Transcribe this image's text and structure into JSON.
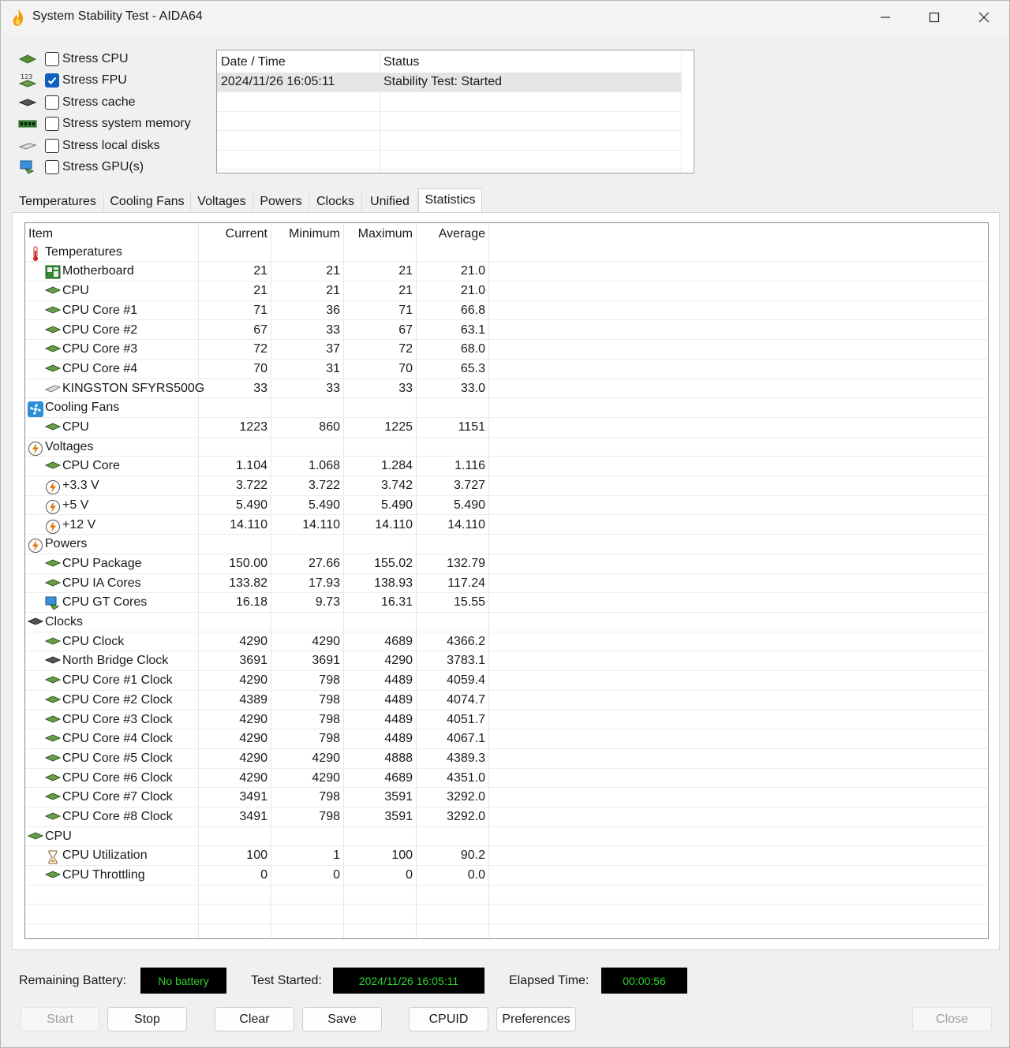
{
  "window": {
    "title": "System Stability Test - AIDA64"
  },
  "stress": [
    {
      "label": "Stress CPU",
      "checked": false,
      "icon": "cpu-chip-icon"
    },
    {
      "label": "Stress FPU",
      "checked": true,
      "icon": "fpu-numbers-icon"
    },
    {
      "label": "Stress cache",
      "checked": false,
      "icon": "cache-chip-icon"
    },
    {
      "label": "Stress system memory",
      "checked": false,
      "icon": "memory-module-icon"
    },
    {
      "label": "Stress local disks",
      "checked": false,
      "icon": "disk-drive-icon"
    },
    {
      "label": "Stress GPU(s)",
      "checked": false,
      "icon": "gpu-monitor-icon"
    }
  ],
  "log": {
    "headers": {
      "datetime": "Date / Time",
      "status": "Status"
    },
    "rows": [
      {
        "datetime": "2024/11/26 16:05:11",
        "status": "Stability Test: Started"
      }
    ]
  },
  "tabs": [
    "Temperatures",
    "Cooling Fans",
    "Voltages",
    "Powers",
    "Clocks",
    "Unified",
    "Statistics"
  ],
  "active_tab": "Statistics",
  "stats": {
    "headers": {
      "item": "Item",
      "current": "Current",
      "minimum": "Minimum",
      "maximum": "Maximum",
      "average": "Average"
    },
    "rows": [
      {
        "type": "group",
        "label": "Temperatures",
        "icon": "thermometer-icon"
      },
      {
        "type": "item",
        "label": "Motherboard",
        "icon": "motherboard-icon",
        "current": "21",
        "min": "21",
        "max": "21",
        "avg": "21.0"
      },
      {
        "type": "item",
        "label": "CPU",
        "icon": "cpu-chip-icon",
        "current": "21",
        "min": "21",
        "max": "21",
        "avg": "21.0"
      },
      {
        "type": "item",
        "label": "CPU Core #1",
        "icon": "cpu-chip-icon",
        "current": "71",
        "min": "36",
        "max": "71",
        "avg": "66.8"
      },
      {
        "type": "item",
        "label": "CPU Core #2",
        "icon": "cpu-chip-icon",
        "current": "67",
        "min": "33",
        "max": "67",
        "avg": "63.1"
      },
      {
        "type": "item",
        "label": "CPU Core #3",
        "icon": "cpu-chip-icon",
        "current": "72",
        "min": "37",
        "max": "72",
        "avg": "68.0"
      },
      {
        "type": "item",
        "label": "CPU Core #4",
        "icon": "cpu-chip-icon",
        "current": "70",
        "min": "31",
        "max": "70",
        "avg": "65.3"
      },
      {
        "type": "item",
        "label": "KINGSTON SFYRS500G",
        "icon": "disk-drive-icon",
        "current": "33",
        "min": "33",
        "max": "33",
        "avg": "33.0"
      },
      {
        "type": "group",
        "label": "Cooling Fans",
        "icon": "fan-icon"
      },
      {
        "type": "item",
        "label": "CPU",
        "icon": "cpu-chip-icon",
        "current": "1223",
        "min": "860",
        "max": "1225",
        "avg": "1151"
      },
      {
        "type": "group",
        "label": "Voltages",
        "icon": "lightning-icon"
      },
      {
        "type": "item",
        "label": "CPU Core",
        "icon": "cpu-chip-icon",
        "current": "1.104",
        "min": "1.068",
        "max": "1.284",
        "avg": "1.116"
      },
      {
        "type": "item",
        "label": "+3.3 V",
        "icon": "lightning-icon",
        "current": "3.722",
        "min": "3.722",
        "max": "3.742",
        "avg": "3.727"
      },
      {
        "type": "item",
        "label": "+5 V",
        "icon": "lightning-icon",
        "current": "5.490",
        "min": "5.490",
        "max": "5.490",
        "avg": "5.490"
      },
      {
        "type": "item",
        "label": "+12 V",
        "icon": "lightning-icon",
        "current": "14.110",
        "min": "14.110",
        "max": "14.110",
        "avg": "14.110"
      },
      {
        "type": "group",
        "label": "Powers",
        "icon": "lightning-icon"
      },
      {
        "type": "item",
        "label": "CPU Package",
        "icon": "cpu-chip-icon",
        "current": "150.00",
        "min": "27.66",
        "max": "155.02",
        "avg": "132.79"
      },
      {
        "type": "item",
        "label": "CPU IA Cores",
        "icon": "cpu-chip-icon",
        "current": "133.82",
        "min": "17.93",
        "max": "138.93",
        "avg": "117.24"
      },
      {
        "type": "item",
        "label": "CPU GT Cores",
        "icon": "gpu-monitor-icon",
        "current": "16.18",
        "min": "9.73",
        "max": "16.31",
        "avg": "15.55"
      },
      {
        "type": "group",
        "label": "Clocks",
        "icon": "chip-icon"
      },
      {
        "type": "item",
        "label": "CPU Clock",
        "icon": "cpu-chip-icon",
        "current": "4290",
        "min": "4290",
        "max": "4689",
        "avg": "4366.2"
      },
      {
        "type": "item",
        "label": "North Bridge Clock",
        "icon": "chip-icon",
        "current": "3691",
        "min": "3691",
        "max": "4290",
        "avg": "3783.1"
      },
      {
        "type": "item",
        "label": "CPU Core #1 Clock",
        "icon": "cpu-chip-icon",
        "current": "4290",
        "min": "798",
        "max": "4489",
        "avg": "4059.4"
      },
      {
        "type": "item",
        "label": "CPU Core #2 Clock",
        "icon": "cpu-chip-icon",
        "current": "4389",
        "min": "798",
        "max": "4489",
        "avg": "4074.7"
      },
      {
        "type": "item",
        "label": "CPU Core #3 Clock",
        "icon": "cpu-chip-icon",
        "current": "4290",
        "min": "798",
        "max": "4489",
        "avg": "4051.7"
      },
      {
        "type": "item",
        "label": "CPU Core #4 Clock",
        "icon": "cpu-chip-icon",
        "current": "4290",
        "min": "798",
        "max": "4489",
        "avg": "4067.1"
      },
      {
        "type": "item",
        "label": "CPU Core #5 Clock",
        "icon": "cpu-chip-icon",
        "current": "4290",
        "min": "4290",
        "max": "4888",
        "avg": "4389.3"
      },
      {
        "type": "item",
        "label": "CPU Core #6 Clock",
        "icon": "cpu-chip-icon",
        "current": "4290",
        "min": "4290",
        "max": "4689",
        "avg": "4351.0"
      },
      {
        "type": "item",
        "label": "CPU Core #7 Clock",
        "icon": "cpu-chip-icon",
        "current": "3491",
        "min": "798",
        "max": "3591",
        "avg": "3292.0"
      },
      {
        "type": "item",
        "label": "CPU Core #8 Clock",
        "icon": "cpu-chip-icon",
        "current": "3491",
        "min": "798",
        "max": "3591",
        "avg": "3292.0"
      },
      {
        "type": "group",
        "label": "CPU",
        "icon": "cpu-chip-icon"
      },
      {
        "type": "item",
        "label": "CPU Utilization",
        "icon": "hourglass-icon",
        "current": "100",
        "min": "1",
        "max": "100",
        "avg": "90.2"
      },
      {
        "type": "item",
        "label": "CPU Throttling",
        "icon": "cpu-chip-icon",
        "current": "0",
        "min": "0",
        "max": "0",
        "avg": "0.0"
      }
    ]
  },
  "status": {
    "battery_label": "Remaining Battery:",
    "battery_value": "No battery",
    "started_label": "Test Started:",
    "started_value": "2024/11/26 16:05:11",
    "elapsed_label": "Elapsed Time:",
    "elapsed_value": "00:00:56",
    "value_color": "#2fd12f"
  },
  "buttons": {
    "start": "Start",
    "stop": "Stop",
    "clear": "Clear",
    "save": "Save",
    "cpuid": "CPUID",
    "preferences": "Preferences",
    "close": "Close"
  },
  "colors": {
    "accent": "#0f5fbf",
    "lightning": "#e07a10",
    "fan": "#2a8fd6"
  }
}
